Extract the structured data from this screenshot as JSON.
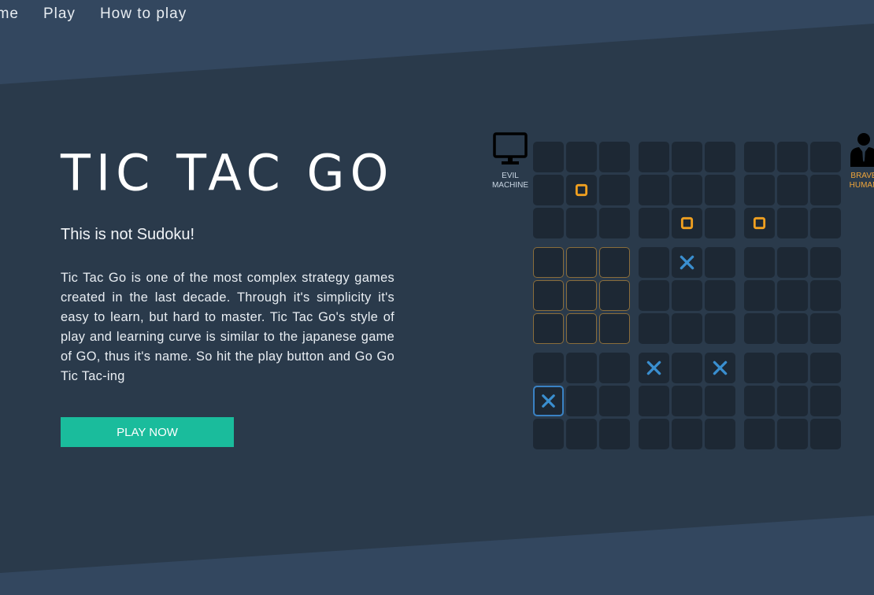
{
  "nav": {
    "items": [
      {
        "label": "ome"
      },
      {
        "label": "Play"
      },
      {
        "label": "How to play"
      }
    ]
  },
  "hero": {
    "title": "TIC TAC GO",
    "subtitle": "This is not Sudoku!",
    "description": "Tic Tac Go is one of the most complex strategy games created in the last decade. Through it's simplicity it's easy to learn, but hard to master. Tic Tac Go's style of play and learning curve is similar to the japanese game of GO, thus it's name. So hit the play button and Go Go Tic Tac-ing",
    "play_button": "PLAY NOW"
  },
  "players": {
    "evil": {
      "line1": "EVIL",
      "line2": "MACHINE",
      "icon": "monitor-icon"
    },
    "brave": {
      "line1": "BRAVE",
      "line2": "HUMAN",
      "icon": "person-icon"
    }
  },
  "colors": {
    "accent": "#1abc9c",
    "o_mark": "#f0a020",
    "x_mark": "#3a8fd0",
    "highlight_border": "#8a6d3b",
    "selected_border": "#3a82c4"
  },
  "board": {
    "rows": 9,
    "cols": 9,
    "marks": [
      {
        "row": 1,
        "col": 1,
        "mark": "O"
      },
      {
        "row": 2,
        "col": 4,
        "mark": "O"
      },
      {
        "row": 2,
        "col": 6,
        "mark": "O"
      },
      {
        "row": 3,
        "col": 4,
        "mark": "X"
      },
      {
        "row": 6,
        "col": 3,
        "mark": "X"
      },
      {
        "row": 6,
        "col": 5,
        "mark": "X"
      },
      {
        "row": 7,
        "col": 0,
        "mark": "X"
      }
    ],
    "highlighted_subgrid": {
      "row": 1,
      "col": 0
    },
    "selected_cell": {
      "row": 7,
      "col": 0
    }
  }
}
